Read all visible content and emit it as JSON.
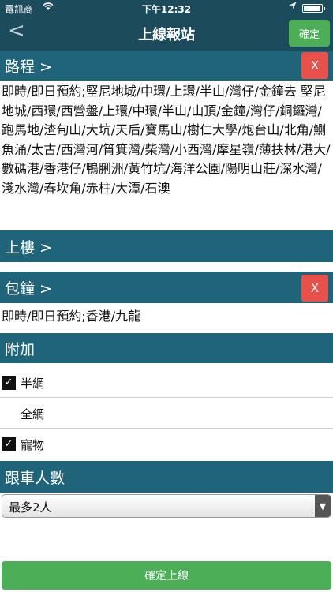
{
  "status_bar": {
    "carrier": "電訊商",
    "wifi_icon": "wifi-icon",
    "time": "下午12:32",
    "location_icon": "location-arrow-icon",
    "battery_icon": "battery-icon"
  },
  "nav": {
    "back_glyph": "<",
    "title": "上線報站",
    "confirm_label": "確定"
  },
  "route": {
    "header": "路程 >",
    "remove_label": "X",
    "text": "即時/即日預約;堅尼地城/中環/上環/半山/灣仔/金鐘去 堅尼地城/西環/西營盤/上環/中環/半山/山頂/金鐘/灣仔/銅鑼灣/跑馬地/渣甸山/大坑/天后/寶馬山/樹仁大學/炮台山/北角/鰂魚涌/太古/西灣河/筲箕灣/柴灣/小西灣/摩星嶺/薄扶林/港大/數碼港/香港仔/鴨脷洲/黃竹坑/海洋公園/陽明山莊/深水灣/淺水灣/春坎角/赤柱/大潭/石澳"
  },
  "upstairs": {
    "header": "上樓 >"
  },
  "charter": {
    "header": "包鐘 >",
    "remove_label": "X",
    "text": "即時/即日預約;香港/九龍"
  },
  "addons": {
    "header": "附加",
    "items": [
      {
        "label": "半網",
        "checked": true,
        "check_glyph": "✓"
      },
      {
        "label": "全網",
        "checked": false,
        "check_glyph": ""
      },
      {
        "label": "寵物",
        "checked": true,
        "check_glyph": "✓"
      }
    ]
  },
  "passengers": {
    "header": "跟車人數",
    "selected": "最多2人",
    "arrow_glyph": "▼"
  },
  "bottom": {
    "confirm_label": "確定上線"
  },
  "colors": {
    "nav_bg": "#1c4c5c",
    "section_bg": "#1f6478",
    "confirm_green": "#4cae57",
    "remove_red": "#e8504a"
  }
}
